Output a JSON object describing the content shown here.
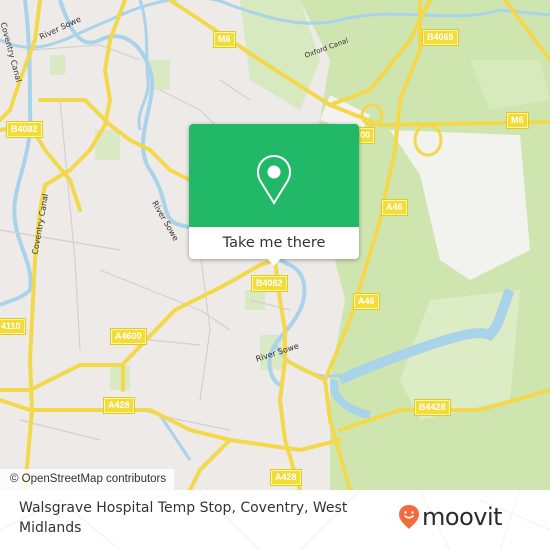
{
  "map": {
    "road_labels": [
      {
        "text": "M6",
        "id": "m6-west"
      },
      {
        "text": "M6",
        "id": "m6-east"
      },
      {
        "text": "B4065",
        "id": "b4065"
      },
      {
        "text": "B4082",
        "id": "b4082-west"
      },
      {
        "text": "B4082",
        "id": "b4082-center"
      },
      {
        "text": "A4600",
        "id": "a4600"
      },
      {
        "text": "A428",
        "id": "a428-west"
      },
      {
        "text": "A428",
        "id": "a428-south"
      },
      {
        "text": "B4428",
        "id": "b4428"
      },
      {
        "text": "A46",
        "id": "a46-north"
      },
      {
        "text": "A46",
        "id": "a46-south"
      },
      {
        "text": "4110",
        "id": "a4110-partial"
      },
      {
        "text": "00",
        "id": "a4600-partial"
      }
    ],
    "water_labels": [
      {
        "text": "River Sowe",
        "id": "river-sowe-north"
      },
      {
        "text": "River Sowe",
        "id": "river-sowe-middle"
      },
      {
        "text": "River Sowe",
        "id": "river-sowe-south"
      },
      {
        "text": "Coventry Canal",
        "id": "coventry-canal-north"
      },
      {
        "text": "Coventry Canal",
        "id": "coventry-canal-south"
      },
      {
        "text": "Oxford Canal",
        "id": "oxford-canal"
      }
    ],
    "attribution": "© OpenStreetMap contributors"
  },
  "popup": {
    "button_label": "Take me there",
    "icon": "map-pin-icon",
    "color": "#21b867"
  },
  "footer": {
    "stop_name": "Walsgrave Hospital Temp Stop, Coventry, West Midlands",
    "logo_text": "moovit",
    "logo_color": "#f26a3d"
  }
}
